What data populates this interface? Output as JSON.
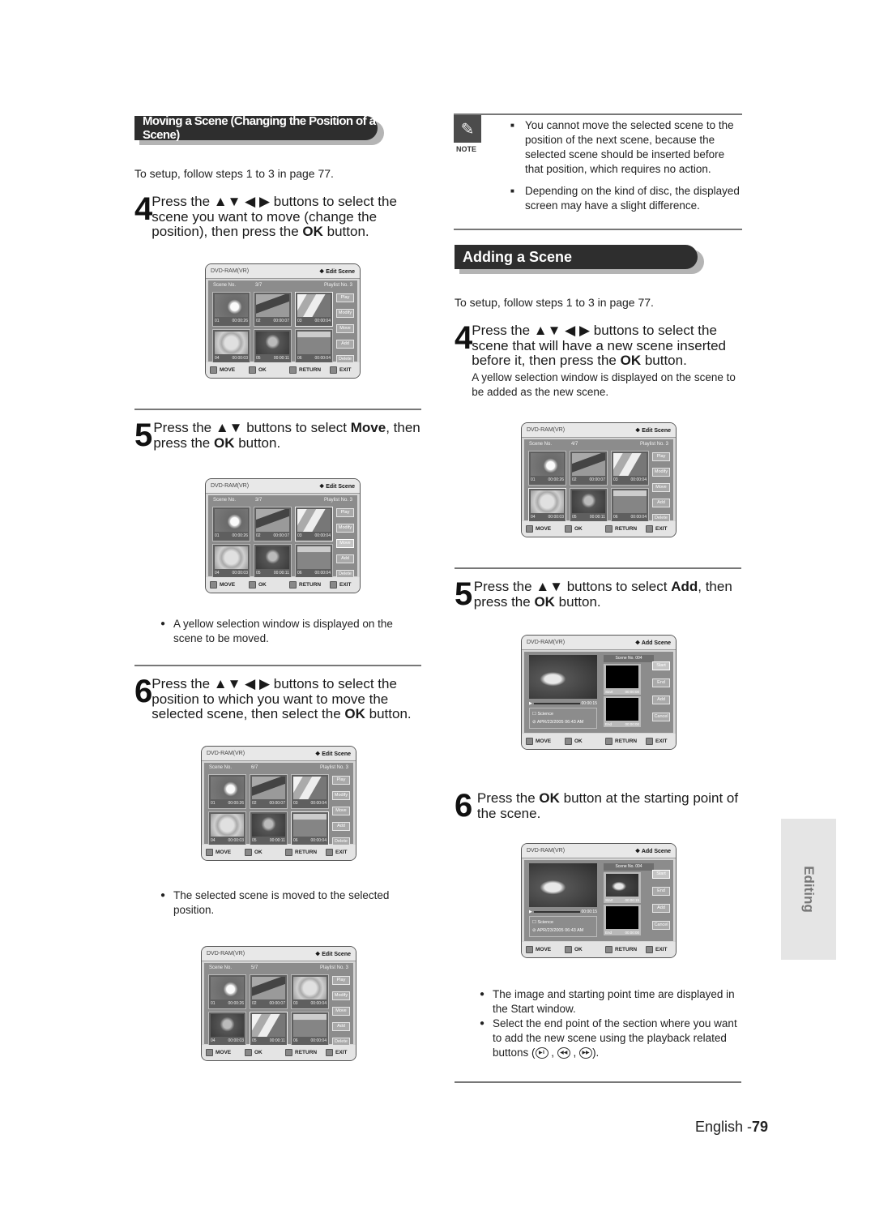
{
  "left": {
    "section_title": "Moving a Scene (Changing the Position of a Scene)",
    "setup": "To setup, follow steps 1 to 3 in page 77.",
    "step4": {
      "num": "4",
      "pre": "Press the ▲▼ ◀ ▶ buttons to select the scene you want to move (change the position), then press the ",
      "bold": "OK",
      "post": " button."
    },
    "step5": {
      "num": "5",
      "pre": "Press the ▲▼ buttons to select ",
      "bold1": "Move",
      "mid": ", then press the ",
      "bold2": "OK",
      "post": " button."
    },
    "step5_bullet": "A yellow selection window is displayed on the scene to be moved.",
    "step6": {
      "num": "6",
      "pre": "Press the ▲▼ ◀ ▶ buttons to select the position to which you want to move the selected scene, then select the ",
      "bold": "OK",
      "post": " button."
    },
    "step6_bullet": "The selected scene is moved to the selected position."
  },
  "right": {
    "note_label": "NOTE",
    "note_icon": "pencil-icon",
    "notes": [
      "You cannot move the selected scene to the position of the next scene, because the selected scene should be inserted before that position, which requires no action.",
      "Depending on the kind of disc, the displayed screen may have a slight difference."
    ],
    "section_title": "Adding a Scene",
    "setup": "To setup, follow steps 1 to 3 in page 77.",
    "step4": {
      "num": "4",
      "pre": "Press the ▲▼ ◀ ▶ buttons to select the scene that will have a new scene inserted before it, then press the ",
      "bold": "OK",
      "post": " button.",
      "sub": "A yellow selection window is displayed on the scene to be added as the new scene."
    },
    "step5": {
      "num": "5",
      "pre": "Press the ▲▼ buttons to select ",
      "bold1": "Add",
      "mid": ", then press the ",
      "bold2": "OK",
      "post": " button."
    },
    "step6": {
      "num": "6",
      "pre": "Press the ",
      "bold": "OK",
      "post": " button at the starting point of the scene."
    },
    "bullets": [
      "The image and starting point time are displayed in the Start window.",
      "Select the end point of the section where you want to add the new scene using the playback related buttons ("
    ],
    "bullet_end": ")."
  },
  "screen_common": {
    "mode": "DVD-RAM(VR)",
    "edit_title": "❖ Edit Scene",
    "add_title": "❖ Add Scene",
    "scene_no_label": "Scene No.",
    "playlist_label": "Playlist No.  3",
    "side_buttons": [
      "Play",
      "Modify",
      "Move",
      "Add",
      "Delete"
    ],
    "add_buttons": [
      "Start",
      "End",
      "Add",
      "Cancel"
    ],
    "footer": {
      "move": "MOVE",
      "ok": "OK",
      "return": "RETURN",
      "exit": "EXIT"
    },
    "add_scene_no": "Scene No. 004",
    "add_time": "00:00:15",
    "add_title_name": "Science",
    "add_date": "APR/23/2005 06:43 AM",
    "start_label": "Start",
    "end_label": "End"
  },
  "screens": {
    "move_s4": {
      "count": "3/7",
      "selected_button": null,
      "selected_thumb": 3,
      "thumbs": [
        [
          "01",
          "00:00:26",
          "flower"
        ],
        [
          "02",
          "00:00:07",
          "dolphin"
        ],
        [
          "03",
          "00:00:04",
          "lily"
        ],
        [
          "04",
          "00:00:03",
          "dahlia"
        ],
        [
          "05",
          "00:00:11",
          "rose"
        ],
        [
          "06",
          "00:00:04",
          "field"
        ]
      ]
    },
    "move_s5": {
      "count": "3/7",
      "selected_button": "Move",
      "selected_thumb": 3,
      "thumbs": [
        [
          "01",
          "00:00:26",
          "flower"
        ],
        [
          "02",
          "00:00:07",
          "dolphin"
        ],
        [
          "03",
          "00:00:04",
          "lily"
        ],
        [
          "04",
          "00:00:03",
          "dahlia"
        ],
        [
          "05",
          "00:00:11",
          "rose"
        ],
        [
          "06",
          "00:00:04",
          "field"
        ]
      ]
    },
    "move_s6": {
      "count": "6/7",
      "selected_button": null,
      "selected_thumb": 6,
      "thumbs": [
        [
          "01",
          "00:00:26",
          "flower"
        ],
        [
          "02",
          "00:00:07",
          "dolphin"
        ],
        [
          "03",
          "00:00:04",
          "lily"
        ],
        [
          "04",
          "00:00:03",
          "dahlia"
        ],
        [
          "05",
          "00:00:11",
          "rose"
        ],
        [
          "06",
          "00:00:04",
          "field"
        ]
      ]
    },
    "move_done": {
      "count": "5/7",
      "selected_button": null,
      "selected_thumb": 5,
      "thumbs": [
        [
          "01",
          "00:00:26",
          "flower"
        ],
        [
          "02",
          "00:00:07",
          "dolphin"
        ],
        [
          "03",
          "00:00:04",
          "dahlia"
        ],
        [
          "04",
          "00:00:03",
          "rose"
        ],
        [
          "05",
          "00:00:11",
          "lily"
        ],
        [
          "06",
          "00:00:04",
          "field"
        ]
      ]
    },
    "add_s4": {
      "count": "4/7",
      "selected_button": null,
      "selected_thumb": 4,
      "thumbs": [
        [
          "01",
          "00:00:26",
          "flower"
        ],
        [
          "02",
          "00:00:07",
          "dolphin"
        ],
        [
          "03",
          "00:00:04",
          "lily"
        ],
        [
          "04",
          "00:00:03",
          "dahlia"
        ],
        [
          "05",
          "00:00:11",
          "rose"
        ],
        [
          "06",
          "00:00:04",
          "field"
        ]
      ]
    },
    "add_s5": {
      "start_time": "00:00:00",
      "end_time": "00:00:00",
      "start_has_image": false
    },
    "add_s6": {
      "start_time": "00:00:15",
      "end_time": "00:00:00",
      "start_has_image": true
    }
  },
  "side_tab": "Editing",
  "footer": {
    "lang": "English -",
    "page": "79"
  }
}
